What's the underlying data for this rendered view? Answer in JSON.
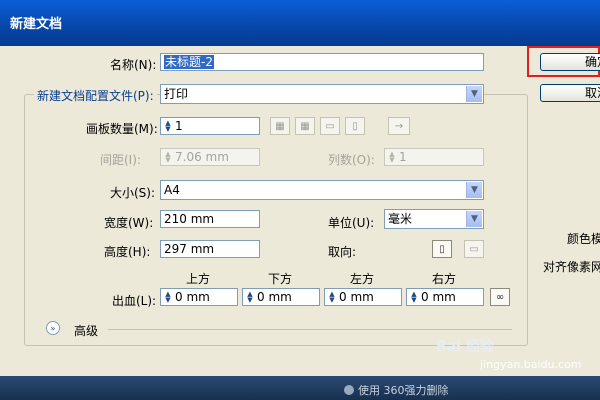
{
  "dialog": {
    "title": "新建文档",
    "name_label": "名称(N):",
    "name_value": "未标题-2",
    "profile_label": "新建文档配置文件(P):",
    "profile_value": "打印",
    "artboards_label": "画板数量(M):",
    "artboards_value": "1",
    "spacing_label": "间距(I):",
    "spacing_value": "7.06 mm",
    "columns_label": "列数(O):",
    "columns_value": "1",
    "size_label": "大小(S):",
    "size_value": "A4",
    "width_label": "宽度(W):",
    "width_value": "210 mm",
    "units_label": "单位(U):",
    "units_value": "毫米",
    "height_label": "高度(H):",
    "height_value": "297 mm",
    "orientation_label": "取向:",
    "bleed_label": "出血(L):",
    "bleed_headers": [
      "上方",
      "下方",
      "左方",
      "右方"
    ],
    "bleed_values": [
      "0 mm",
      "0 mm",
      "0 mm",
      "0 mm"
    ],
    "advanced_label": "高级",
    "ok_label": "确定",
    "cancel_label": "取消",
    "side_label_1": "颜色模",
    "side_label_2": "对齐像素网"
  },
  "watermark": {
    "text": "使用 360强力删除",
    "brand": "Bai 经验",
    "url": "jingyan.baidu.com"
  }
}
